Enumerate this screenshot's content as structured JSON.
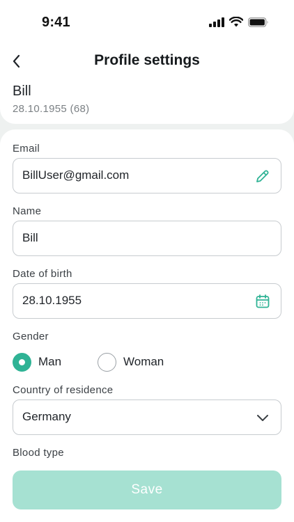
{
  "status_bar": {
    "time": "9:41"
  },
  "nav": {
    "title": "Profile settings"
  },
  "profile": {
    "name": "Bill",
    "dob": "28.10.1955 (68)"
  },
  "form": {
    "email": {
      "label": "Email",
      "value": "BillUser@gmail.com"
    },
    "name": {
      "label": "Name",
      "value": "Bill"
    },
    "dob": {
      "label": "Date of birth",
      "value": "28.10.1955"
    },
    "gender": {
      "label": "Gender",
      "options": [
        {
          "label": "Man",
          "selected": true
        },
        {
          "label": "Woman",
          "selected": false
        }
      ]
    },
    "country": {
      "label": "Country of residence",
      "value": "Germany"
    },
    "blood_type": {
      "label": "Blood type"
    }
  },
  "save_label": "Save",
  "colors": {
    "accent": "#2fb395",
    "save_disabled": "#a6e1d2"
  },
  "icons": [
    "back-chevron-icon",
    "edit-pencil-icon",
    "calendar-icon",
    "chevron-down-icon",
    "signal-icon",
    "wifi-icon",
    "battery-icon"
  ]
}
